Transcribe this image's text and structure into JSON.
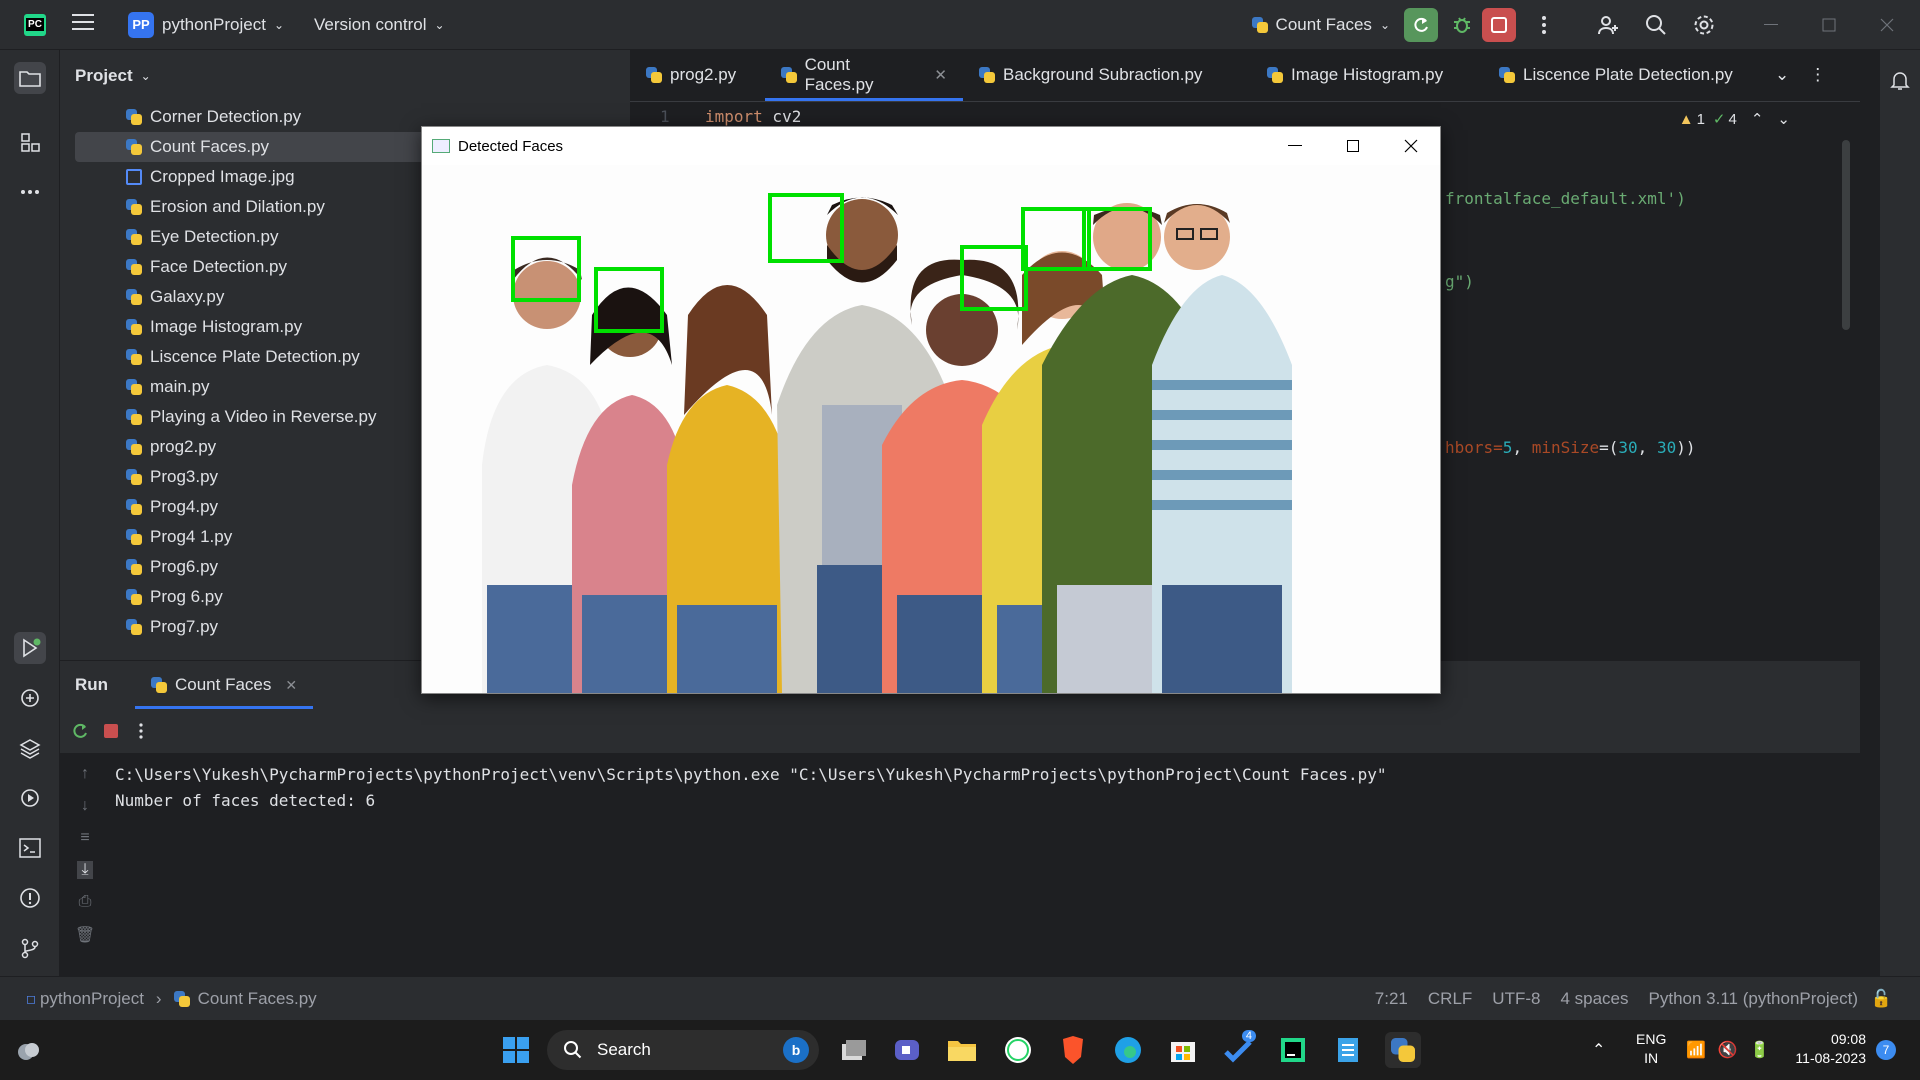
{
  "titlebar": {
    "project_badge": "PP",
    "project_name": "pythonProject",
    "version_control": "Version control",
    "run_config": "Count Faces"
  },
  "project_panel": {
    "title": "Project",
    "files": [
      {
        "name": "Corner Detection.py",
        "type": "py"
      },
      {
        "name": "Count Faces.py",
        "type": "py",
        "selected": true
      },
      {
        "name": "Cropped Image.jpg",
        "type": "img"
      },
      {
        "name": "Erosion and Dilation.py",
        "type": "py"
      },
      {
        "name": "Eye Detection.py",
        "type": "py"
      },
      {
        "name": "Face Detection.py",
        "type": "py"
      },
      {
        "name": "Galaxy.py",
        "type": "py"
      },
      {
        "name": "Image Histogram.py",
        "type": "py"
      },
      {
        "name": "Liscence Plate Detection.py",
        "type": "py"
      },
      {
        "name": "main.py",
        "type": "py"
      },
      {
        "name": "Playing a Video in Reverse.py",
        "type": "py"
      },
      {
        "name": "prog2.py",
        "type": "py"
      },
      {
        "name": "Prog3.py",
        "type": "py"
      },
      {
        "name": "Prog4.py",
        "type": "py"
      },
      {
        "name": "Prog4 1.py",
        "type": "py"
      },
      {
        "name": "Prog6.py",
        "type": "py"
      },
      {
        "name": "Prog 6.py",
        "type": "py"
      },
      {
        "name": "Prog7.py",
        "type": "py"
      }
    ]
  },
  "editor": {
    "tabs": [
      "prog2.py",
      "Count Faces.py",
      "Background Subraction.py",
      "Image Histogram.py",
      "Liscence Plate Detection.py"
    ],
    "active_tab": "Count Faces.py",
    "line_number": "1",
    "code_kw": "import",
    "code_mod": " cv2",
    "fragment_1": "frontalface_default.xml')",
    "fragment_2": "g\")",
    "fragment_3a": "hbors=",
    "fragment_3b": "5",
    "fragment_3c": ", ",
    "fragment_3d": "minSize",
    "fragment_3e": "=(",
    "fragment_3f": "30",
    "fragment_3g": ", ",
    "fragment_3h": "30",
    "fragment_3i": "))",
    "warnings": "1",
    "checks": "4"
  },
  "face_window": {
    "title": "Detected Faces",
    "faces_detected": 6
  },
  "run_panel": {
    "title": "Run",
    "tab": "Count Faces",
    "console": [
      "C:\\Users\\Yukesh\\PycharmProjects\\pythonProject\\venv\\Scripts\\python.exe \"C:\\Users\\Yukesh\\PycharmProjects\\pythonProject\\Count Faces.py\"",
      "Number of faces detected: 6"
    ]
  },
  "statusbar": {
    "breadcrumb_project": "pythonProject",
    "breadcrumb_file": "Count Faces.py",
    "position": "7:21",
    "line_sep": "CRLF",
    "encoding": "UTF-8",
    "indent": "4 spaces",
    "interpreter": "Python 3.11 (pythonProject)"
  },
  "taskbar": {
    "search_placeholder": "Search",
    "lang_top": "ENG",
    "lang_bottom": "IN",
    "time": "09:08",
    "date": "11-08-2023",
    "notif_count": "7",
    "todo_badge": "4"
  }
}
